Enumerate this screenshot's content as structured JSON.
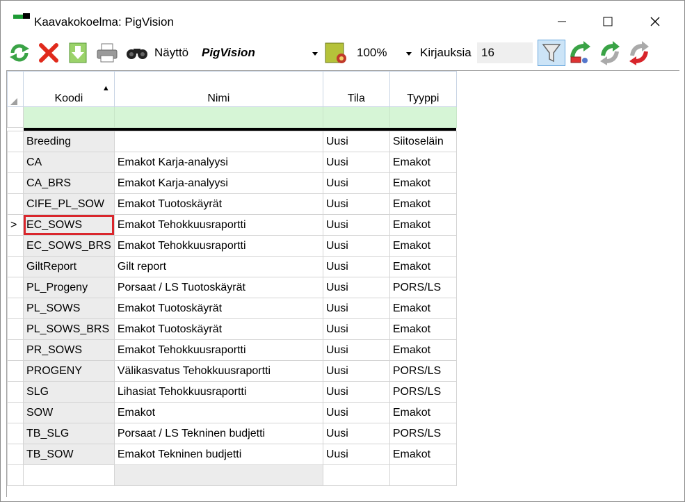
{
  "window": {
    "title": "Kaavakokoelma: PigVision"
  },
  "toolbar": {
    "view_label": "Näyttö",
    "view_value": "PigVision",
    "zoom_value": "100%",
    "count_label": "Kirjauksia",
    "count_value": "16"
  },
  "grid": {
    "columns": [
      "Koodi",
      "Nimi",
      "Tila",
      "Tyyppi"
    ],
    "current_row_marker": ">",
    "rows": [
      {
        "code": "Breeding",
        "name": "",
        "status": "Uusi",
        "type": "Siitoseläin"
      },
      {
        "code": "CA",
        "name": "Emakot Karja-analyysi",
        "status": "Uusi",
        "type": "Emakot"
      },
      {
        "code": "CA_BRS",
        "name": "Emakot Karja-analyysi",
        "status": "Uusi",
        "type": "Emakot"
      },
      {
        "code": "CIFE_PL_SOW",
        "name": "Emakot Tuotoskäyrät",
        "status": "Uusi",
        "type": "Emakot"
      },
      {
        "code": "EC_SOWS",
        "name": "Emakot Tehokkuusraportti",
        "status": "Uusi",
        "type": "Emakot"
      },
      {
        "code": "EC_SOWS_BRS",
        "name": "Emakot Tehokkuusraportti",
        "status": "Uusi",
        "type": "Emakot"
      },
      {
        "code": "GiltReport",
        "name": "Gilt report",
        "status": "Uusi",
        "type": "Emakot"
      },
      {
        "code": "PL_Progeny",
        "name": "Porsaat / LS Tuotoskäyrät",
        "status": "Uusi",
        "type": "PORS/LS"
      },
      {
        "code": "PL_SOWS",
        "name": "Emakot Tuotoskäyrät",
        "status": "Uusi",
        "type": "Emakot"
      },
      {
        "code": "PL_SOWS_BRS",
        "name": "Emakot Tuotoskäyrät",
        "status": "Uusi",
        "type": "Emakot"
      },
      {
        "code": "PR_SOWS",
        "name": "Emakot Tehokkuusraportti",
        "status": "Uusi",
        "type": "Emakot"
      },
      {
        "code": "PROGENY",
        "name": "Välikasvatus Tehokkuusraportti",
        "status": "Uusi",
        "type": "PORS/LS"
      },
      {
        "code": "SLG",
        "name": "Lihasiat Tehokkuusraportti",
        "status": "Uusi",
        "type": "PORS/LS"
      },
      {
        "code": "SOW",
        "name": "Emakot",
        "status": "Uusi",
        "type": "Emakot"
      },
      {
        "code": "TB_SLG",
        "name": "Porsaat / LS Tekninen budjetti",
        "status": "Uusi",
        "type": "PORS/LS"
      },
      {
        "code": "TB_SOW",
        "name": "Emakot Tekninen budjetti",
        "status": "Uusi",
        "type": "Emakot"
      }
    ]
  },
  "colors": {
    "highlight": "#d9262c",
    "filter_row": "#d6f5d6",
    "sorted_header": "#ffd083"
  }
}
